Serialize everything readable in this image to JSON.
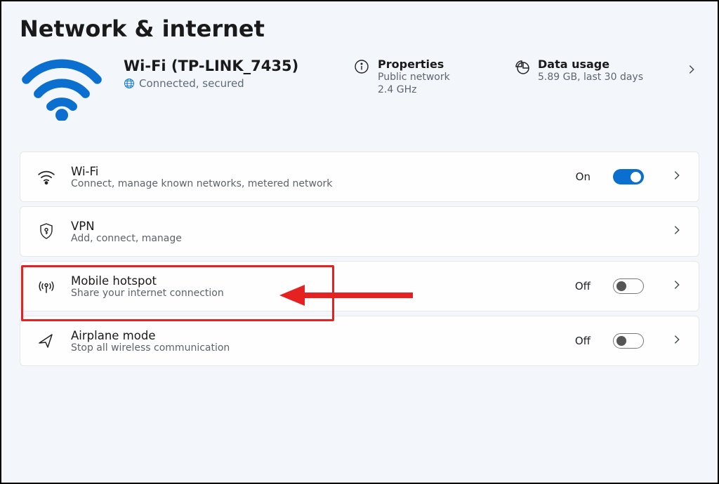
{
  "page_title": "Network & internet",
  "status": {
    "name": "Wi-Fi (TP-LINK_7435)",
    "state": "Connected, secured",
    "properties": {
      "title": "Properties",
      "line1": "Public network",
      "line2": "2.4 GHz"
    },
    "usage": {
      "title": "Data usage",
      "line1": "5.89 GB, last 30 days"
    }
  },
  "items": [
    {
      "title": "Wi-Fi",
      "subtitle": "Connect, manage known networks, metered network",
      "state": "On",
      "toggle": "on"
    },
    {
      "title": "VPN",
      "subtitle": "Add, connect, manage",
      "state": "",
      "toggle": ""
    },
    {
      "title": "Mobile hotspot",
      "subtitle": "Share your internet connection",
      "state": "Off",
      "toggle": "off"
    },
    {
      "title": "Airplane mode",
      "subtitle": "Stop all wireless communication",
      "state": "Off",
      "toggle": "off"
    }
  ]
}
